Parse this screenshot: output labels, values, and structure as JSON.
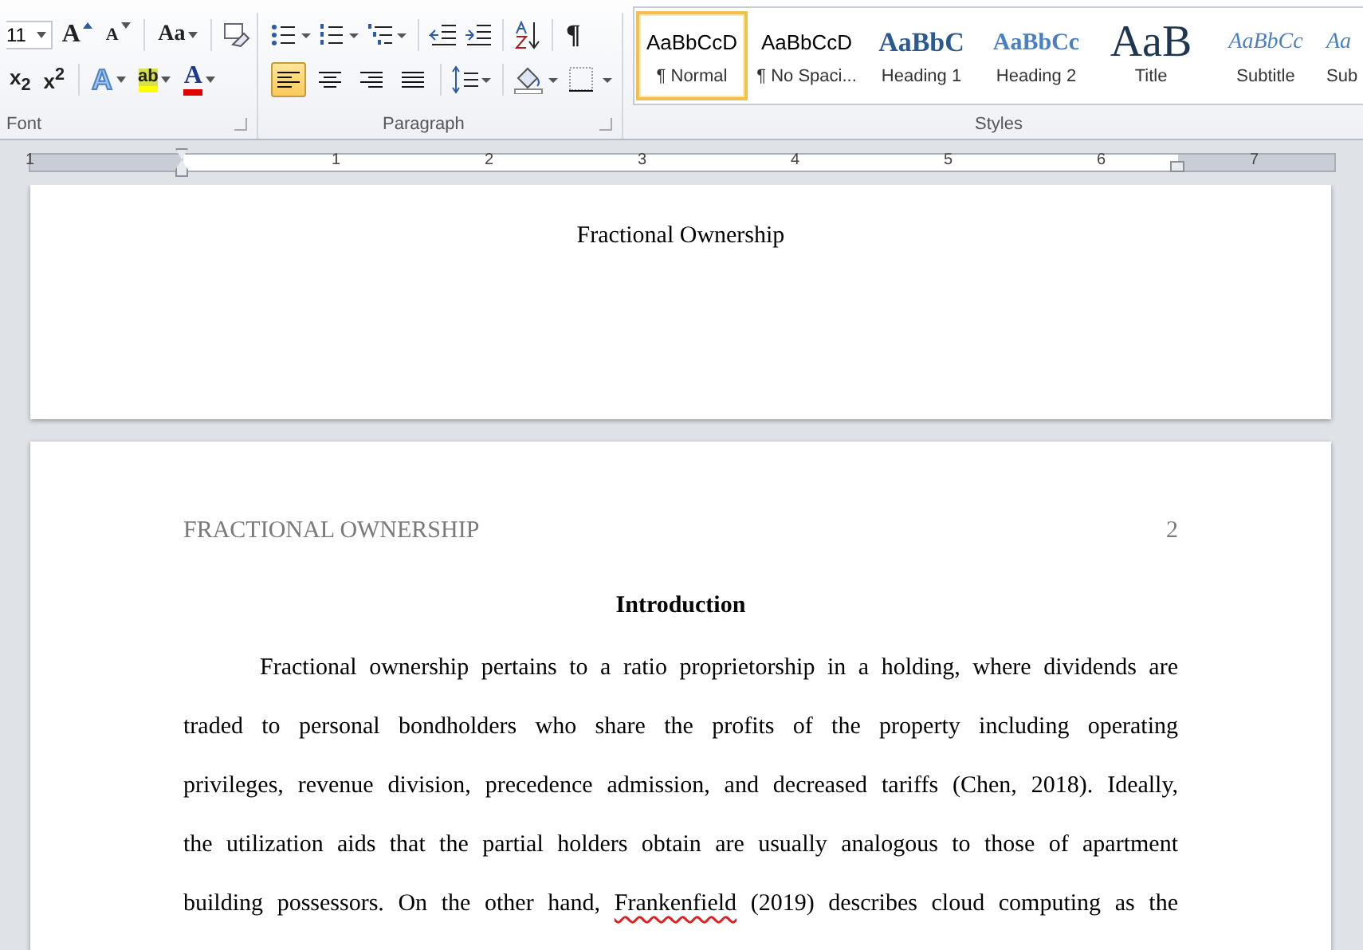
{
  "ribbon": {
    "font_group": {
      "label": "Font",
      "font_size": "11",
      "grow_font": "A",
      "shrink_font": "A",
      "change_case": "Aa",
      "subscript": "x$_{2}$",
      "superscript": "x$^{2}$",
      "text_effects": "A",
      "highlight": "ab",
      "font_color": "A"
    },
    "paragraph_group": {
      "label": "Paragraph",
      "show_marks": "¶",
      "alignments": [
        {
          "kind": "left",
          "selected": true
        },
        {
          "kind": "center",
          "selected": false
        },
        {
          "kind": "right",
          "selected": false
        },
        {
          "kind": "justify",
          "selected": false
        }
      ]
    },
    "styles_group": {
      "label": "Styles",
      "styles": [
        {
          "preview": "AaBbCcD",
          "name": "¶ Normal",
          "kind": "plain",
          "selected": true
        },
        {
          "preview": "AaBbCcD",
          "name": "¶ No Spaci...",
          "kind": "plain",
          "selected": false
        },
        {
          "preview": "AaBbC",
          "name": "Heading 1",
          "kind": "heading1",
          "selected": false
        },
        {
          "preview": "AaBbCc",
          "name": "Heading 2",
          "kind": "heading2",
          "selected": false
        },
        {
          "preview": "AaB",
          "name": "Title",
          "kind": "title",
          "selected": false
        },
        {
          "preview": "AaBbCc",
          "name": "Subtitle",
          "kind": "subtitle",
          "selected": false
        },
        {
          "preview": "Aa",
          "name": "Sub",
          "kind": "subtitle",
          "selected": false
        }
      ]
    }
  },
  "ruler": {
    "numbers": [
      "1",
      "1",
      "2",
      "3",
      "4",
      "5",
      "6",
      "7"
    ]
  },
  "pages": [
    {
      "kind": "title",
      "header_title": "Fractional Ownership"
    },
    {
      "kind": "body",
      "running_head": "FRACTIONAL OWNERSHIP",
      "page_number": "2",
      "heading": "Introduction",
      "lines": [
        [
          {
            "text": "Fractional ownership pertains to a ratio proprietorship in a holding, where dividends are",
            "misspelled": false
          }
        ],
        [
          {
            "text": "traded to personal bondholders who share the profits of the property including operating",
            "misspelled": false
          }
        ],
        [
          {
            "text": "privileges, revenue division, precedence admission, and decreased tariffs (Chen, 2018). Ideally,",
            "misspelled": false
          }
        ],
        [
          {
            "text": "the utilization aids that the partial holders obtain are usually analogous to those of apartment",
            "misspelled": false
          }
        ],
        [
          {
            "text": "building possessors.  On the other hand, ",
            "misspelled": false
          },
          {
            "text": "Frankenfield",
            "misspelled": true
          },
          {
            "text": " (2019) describes cloud computing as the",
            "misspelled": false
          }
        ]
      ]
    }
  ]
}
